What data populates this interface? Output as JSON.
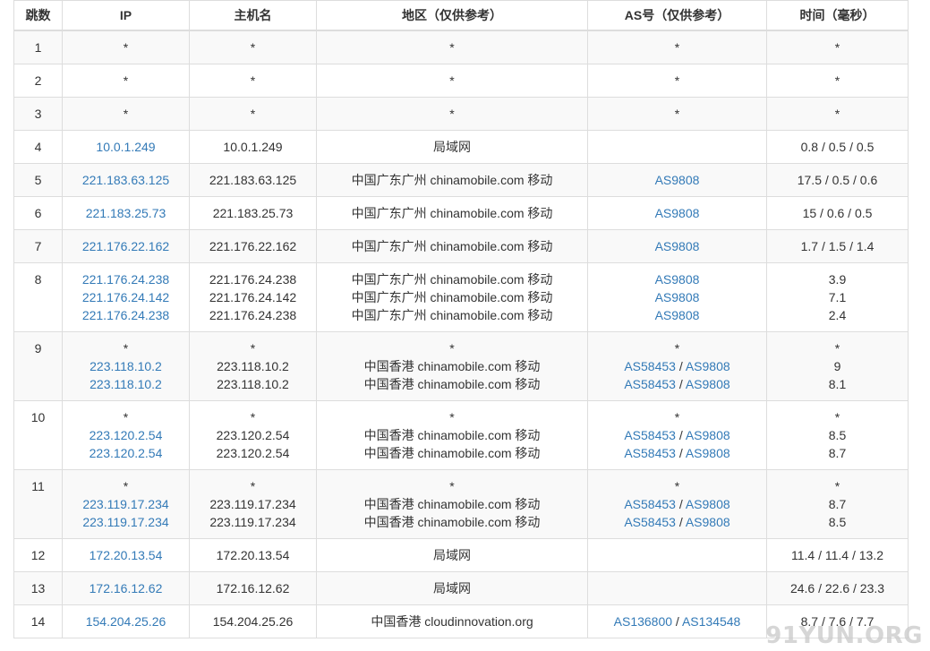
{
  "headers": {
    "hop": "跳数",
    "ip": "IP",
    "host": "主机名",
    "region": "地区（仅供参考）",
    "as": "AS号（仅供参考）",
    "time": "时间（毫秒）"
  },
  "rows": [
    {
      "hop": "1",
      "ips": [
        "*"
      ],
      "hosts": [
        "*"
      ],
      "regions": [
        "*"
      ],
      "as": [
        [
          "*"
        ]
      ],
      "times": [
        "*"
      ]
    },
    {
      "hop": "2",
      "ips": [
        "*"
      ],
      "hosts": [
        "*"
      ],
      "regions": [
        "*"
      ],
      "as": [
        [
          "*"
        ]
      ],
      "times": [
        "*"
      ]
    },
    {
      "hop": "3",
      "ips": [
        "*"
      ],
      "hosts": [
        "*"
      ],
      "regions": [
        "*"
      ],
      "as": [
        [
          "*"
        ]
      ],
      "times": [
        "*"
      ]
    },
    {
      "hop": "4",
      "ips": [
        "10.0.1.249"
      ],
      "hosts": [
        "10.0.1.249"
      ],
      "regions": [
        "局域网"
      ],
      "as": [
        []
      ],
      "times": [
        "0.8 / 0.5 / 0.5"
      ]
    },
    {
      "hop": "5",
      "ips": [
        "221.183.63.125"
      ],
      "hosts": [
        "221.183.63.125"
      ],
      "regions": [
        "中国广东广州 chinamobile.com 移动"
      ],
      "as": [
        [
          "AS9808"
        ]
      ],
      "times": [
        "17.5 / 0.5 / 0.6"
      ]
    },
    {
      "hop": "6",
      "ips": [
        "221.183.25.73"
      ],
      "hosts": [
        "221.183.25.73"
      ],
      "regions": [
        "中国广东广州 chinamobile.com 移动"
      ],
      "as": [
        [
          "AS9808"
        ]
      ],
      "times": [
        "15 / 0.6 / 0.5"
      ]
    },
    {
      "hop": "7",
      "ips": [
        "221.176.22.162"
      ],
      "hosts": [
        "221.176.22.162"
      ],
      "regions": [
        "中国广东广州 chinamobile.com 移动"
      ],
      "as": [
        [
          "AS9808"
        ]
      ],
      "times": [
        "1.7 / 1.5 / 1.4"
      ]
    },
    {
      "hop": "8",
      "ips": [
        "221.176.24.238",
        "221.176.24.142",
        "221.176.24.238"
      ],
      "hosts": [
        "221.176.24.238",
        "221.176.24.142",
        "221.176.24.238"
      ],
      "regions": [
        "中国广东广州 chinamobile.com 移动",
        "中国广东广州 chinamobile.com 移动",
        "中国广东广州 chinamobile.com 移动"
      ],
      "as": [
        [
          "AS9808"
        ],
        [
          "AS9808"
        ],
        [
          "AS9808"
        ]
      ],
      "times": [
        "3.9",
        "7.1",
        "2.4"
      ]
    },
    {
      "hop": "9",
      "ips": [
        "*",
        "223.118.10.2",
        "223.118.10.2"
      ],
      "hosts": [
        "*",
        "223.118.10.2",
        "223.118.10.2"
      ],
      "regions": [
        "*",
        "中国香港 chinamobile.com 移动",
        "中国香港 chinamobile.com 移动"
      ],
      "as": [
        [
          "*"
        ],
        [
          "AS58453",
          "AS9808"
        ],
        [
          "AS58453",
          "AS9808"
        ]
      ],
      "times": [
        "*",
        "9",
        "8.1"
      ]
    },
    {
      "hop": "10",
      "ips": [
        "*",
        "223.120.2.54",
        "223.120.2.54"
      ],
      "hosts": [
        "*",
        "223.120.2.54",
        "223.120.2.54"
      ],
      "regions": [
        "*",
        "中国香港 chinamobile.com 移动",
        "中国香港 chinamobile.com 移动"
      ],
      "as": [
        [
          "*"
        ],
        [
          "AS58453",
          "AS9808"
        ],
        [
          "AS58453",
          "AS9808"
        ]
      ],
      "times": [
        "*",
        "8.5",
        "8.7"
      ]
    },
    {
      "hop": "11",
      "ips": [
        "*",
        "223.119.17.234",
        "223.119.17.234"
      ],
      "hosts": [
        "*",
        "223.119.17.234",
        "223.119.17.234"
      ],
      "regions": [
        "*",
        "中国香港 chinamobile.com 移动",
        "中国香港 chinamobile.com 移动"
      ],
      "as": [
        [
          "*"
        ],
        [
          "AS58453",
          "AS9808"
        ],
        [
          "AS58453",
          "AS9808"
        ]
      ],
      "times": [
        "*",
        "8.7",
        "8.5"
      ]
    },
    {
      "hop": "12",
      "ips": [
        "172.20.13.54"
      ],
      "hosts": [
        "172.20.13.54"
      ],
      "regions": [
        "局域网"
      ],
      "as": [
        []
      ],
      "times": [
        "11.4 / 11.4 / 13.2"
      ]
    },
    {
      "hop": "13",
      "ips": [
        "172.16.12.62"
      ],
      "hosts": [
        "172.16.12.62"
      ],
      "regions": [
        "局域网"
      ],
      "as": [
        []
      ],
      "times": [
        "24.6 / 22.6 / 23.3"
      ]
    },
    {
      "hop": "14",
      "ips": [
        "154.204.25.26"
      ],
      "hosts": [
        "154.204.25.26"
      ],
      "regions": [
        "中国香港 cloudinnovation.org"
      ],
      "as": [
        [
          "AS136800",
          "AS134548"
        ]
      ],
      "times": [
        "8.7 / 7.6 / 7.7"
      ]
    }
  ],
  "watermark": "91YUN.ORG",
  "colors": {
    "link": "#337ab7",
    "border": "#dddddd",
    "stripe": "#f9f9f9"
  }
}
